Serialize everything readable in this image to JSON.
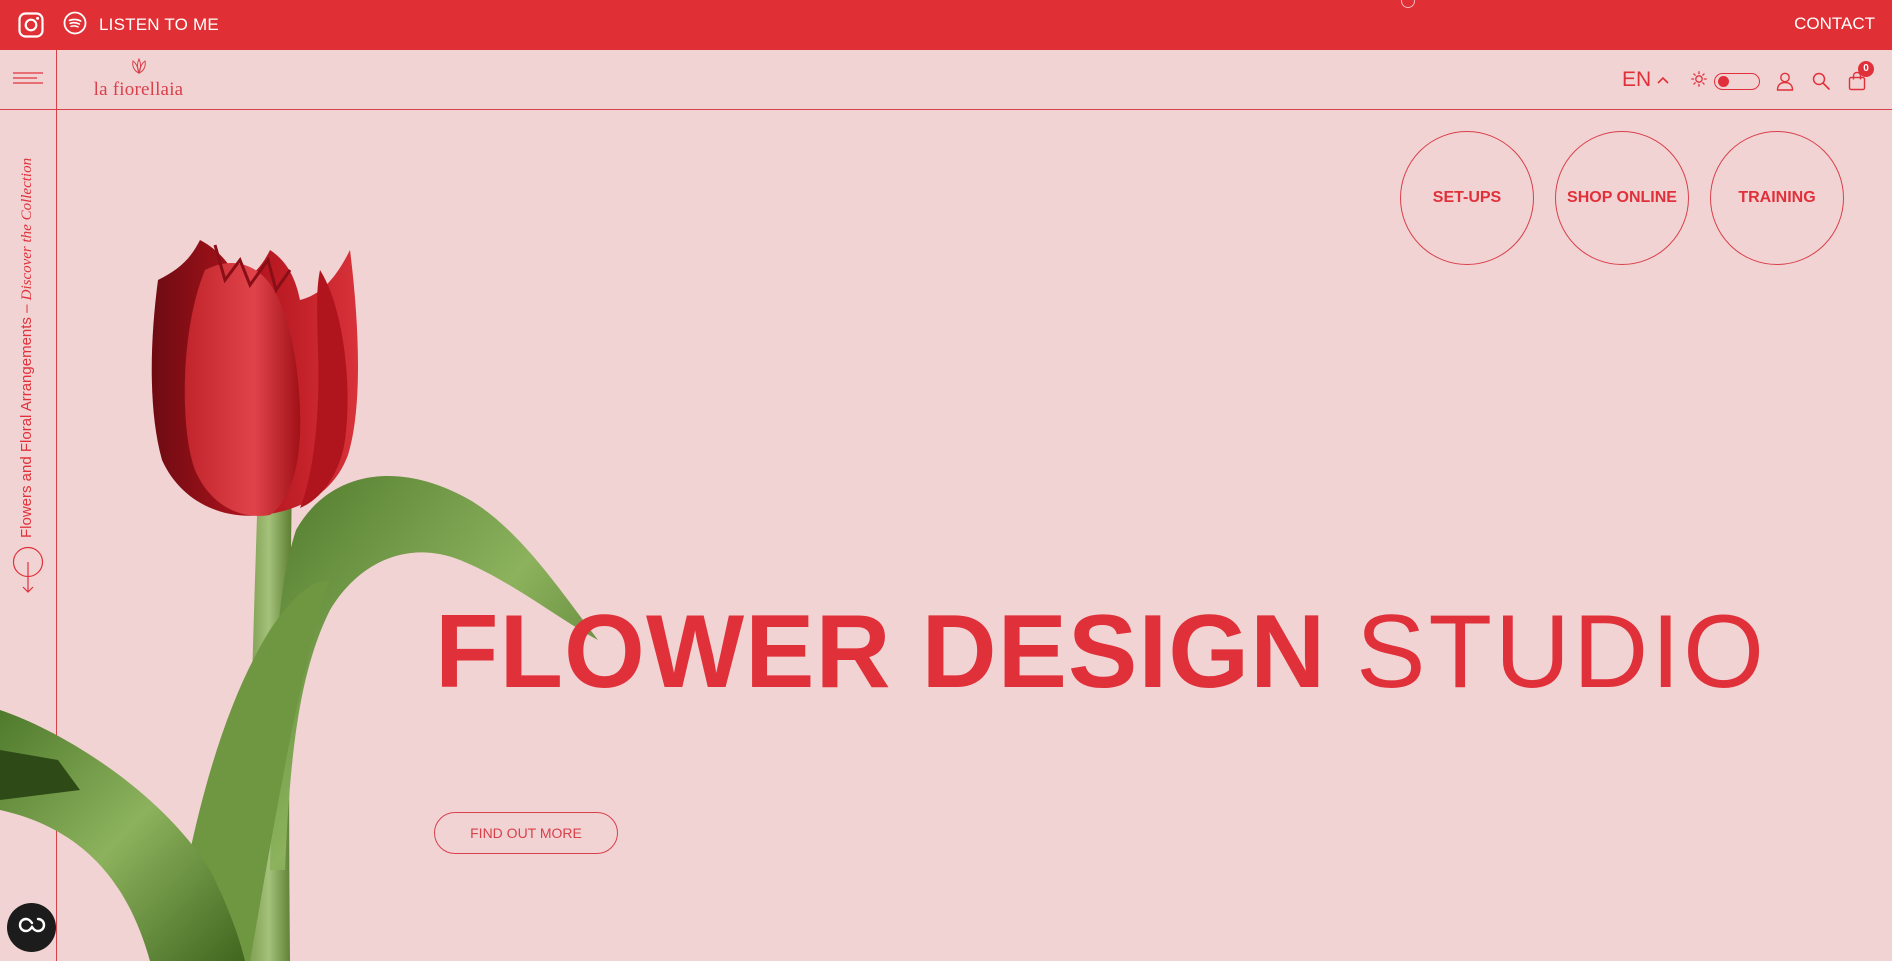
{
  "topbar": {
    "listen_label": "LISTEN TO ME",
    "contact_label": "CONTACT"
  },
  "header": {
    "logo_text": "la fiorellaia",
    "language": "EN",
    "cart_count": "0"
  },
  "rail": {
    "text_main": "Flowers and Floral Arrangements – ",
    "text_italic": "Discover the Collection"
  },
  "circles": [
    {
      "label": "SET-UPS"
    },
    {
      "label": "SHOP ONLINE"
    },
    {
      "label": "TRAINING"
    }
  ],
  "hero": {
    "headline_bold": "FLOWER DESIGN",
    "headline_light": "STUDIO",
    "cta_label": "FIND OUT MORE"
  },
  "colors": {
    "accent": "#e0313a",
    "background": "#f2d3d4",
    "topbar": "#e03035"
  },
  "icons": [
    "instagram-icon",
    "spotify-icon",
    "hamburger-menu-icon",
    "chevron-up-icon",
    "sun-icon",
    "user-icon",
    "search-icon",
    "cart-icon",
    "scroll-down-icon",
    "accessibility-icon"
  ]
}
